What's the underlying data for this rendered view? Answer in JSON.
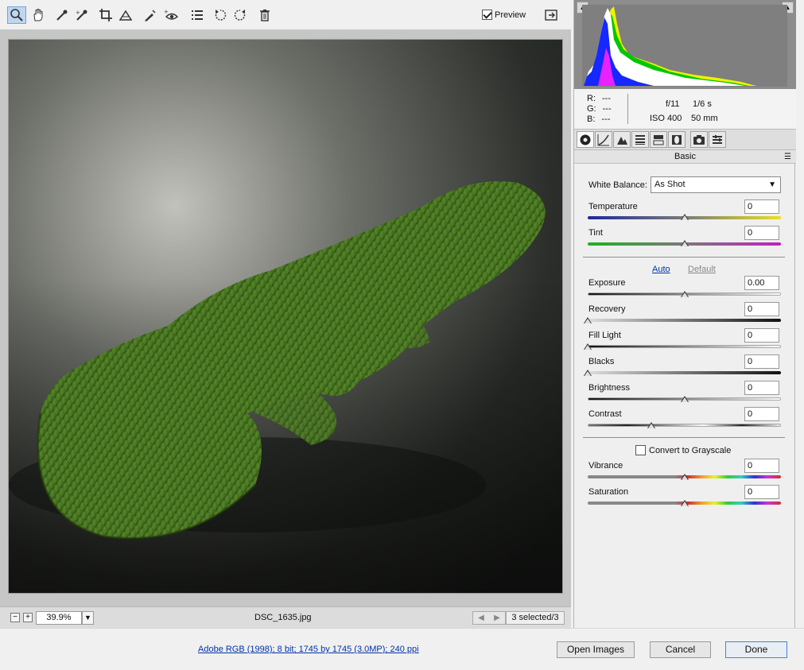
{
  "toolbar": {
    "tools": [
      "zoom-icon",
      "hand-icon",
      "white-balance-icon",
      "color-sampler-icon",
      "crop-icon",
      "straighten-icon",
      "retouch-icon",
      "red-eye-icon",
      "preferences-icon",
      "rotate-ccw-icon",
      "rotate-cw-icon",
      "trash-icon"
    ],
    "preview_label": "Preview",
    "preview_checked": true
  },
  "status": {
    "zoom_value": "39.9%",
    "filename": "DSC_1635.jpg",
    "selected": "3 selected/3"
  },
  "info": {
    "r_label": "R:",
    "r_value": "---",
    "g_label": "G:",
    "g_value": "---",
    "b_label": "B:",
    "b_value": "---",
    "aperture": "f/11",
    "shutter": "1/6 s",
    "iso": "ISO 400",
    "focal": "50 mm"
  },
  "panel": {
    "title": "Basic",
    "white_balance_label": "White Balance:",
    "white_balance_value": "As Shot",
    "auto_label": "Auto",
    "default_label": "Default",
    "grayscale_label": "Convert to Grayscale",
    "grayscale_checked": false,
    "sliders": {
      "temperature": {
        "label": "Temperature",
        "value": "0",
        "level": 0.5
      },
      "tint": {
        "label": "Tint",
        "value": "0",
        "level": 0.5
      },
      "exposure": {
        "label": "Exposure",
        "value": "0.00",
        "level": 0.5
      },
      "recovery": {
        "label": "Recovery",
        "value": "0",
        "level": 0
      },
      "fill_light": {
        "label": "Fill Light",
        "value": "0",
        "level": 0
      },
      "blacks": {
        "label": "Blacks",
        "value": "0",
        "level": 0
      },
      "brightness": {
        "label": "Brightness",
        "value": "0",
        "level": 0.5
      },
      "contrast": {
        "label": "Contrast",
        "value": "0",
        "level": 0.33
      },
      "vibrance": {
        "label": "Vibrance",
        "value": "0",
        "level": 0.5
      },
      "saturation": {
        "label": "Saturation",
        "value": "0",
        "level": 0.5
      }
    }
  },
  "footer": {
    "workflow_link": "Adobe RGB (1998); 8 bit; 1745 by 1745 (3.0MP); 240 ppi",
    "open_images": "Open Images",
    "cancel": "Cancel",
    "done": "Done"
  },
  "colors": {
    "accent_link": "#0033aa",
    "yarn_green": "#3f6a1c",
    "histogram_bg": "#8c8c8c"
  }
}
